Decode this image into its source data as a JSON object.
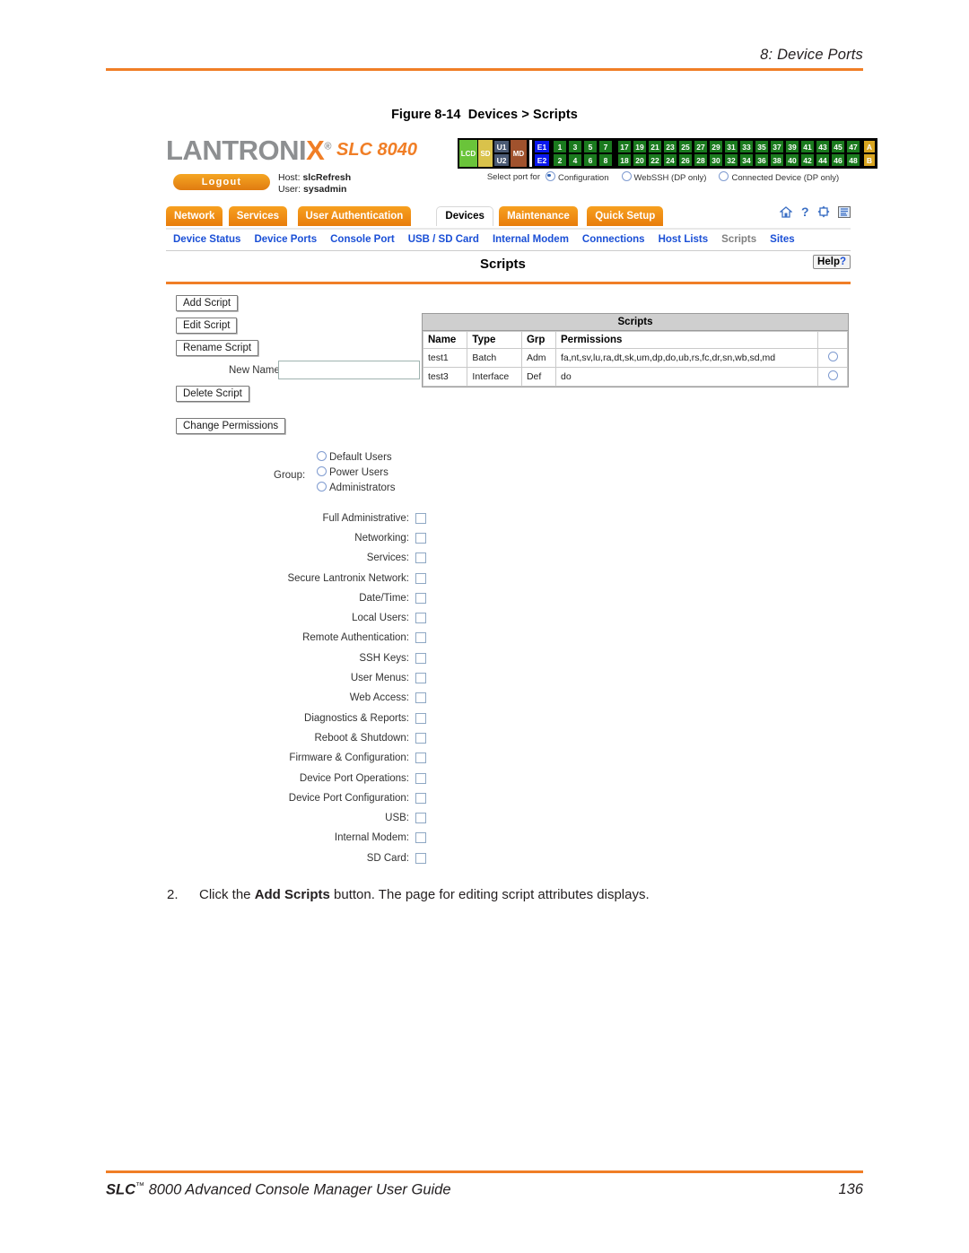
{
  "page": {
    "header_title": "8: Device Ports",
    "figure_caption_number": "Figure 8-14",
    "figure_caption_text": "Devices > Scripts",
    "footer_left_prefix": "SLC",
    "footer_left_tm": "™",
    "footer_left": " 8000 Advanced Console Manager User Guide",
    "footer_page": "136",
    "accent_color": "#F07E26"
  },
  "step": {
    "number": "2.",
    "before": "Click the ",
    "bold": "Add Scripts",
    "after": " button. The page for editing script attributes displays."
  },
  "app": {
    "brand_lan": "LANTRONI",
    "brand_x": "X",
    "brand_reg": "®",
    "model": "SLC 8040",
    "logout_label": "Logout",
    "host_label": "Host:",
    "host_value": "slcRefresh",
    "user_label": "User:",
    "user_value": "sysadmin"
  },
  "port_panel": {
    "status_cells": [
      "LCD",
      "SD"
    ],
    "u_cells": [
      "U1",
      "U2"
    ],
    "md_cell": "MD",
    "e_cells": [
      "E1",
      "E2"
    ],
    "ports_top": [
      "1",
      "3",
      "5",
      "7",
      "17",
      "19",
      "21",
      "23",
      "25",
      "27",
      "29",
      "31",
      "33",
      "35",
      "37",
      "39",
      "41",
      "43",
      "45",
      "47"
    ],
    "ports_bottom": [
      "2",
      "4",
      "6",
      "8",
      "18",
      "20",
      "22",
      "24",
      "26",
      "28",
      "30",
      "32",
      "34",
      "36",
      "38",
      "40",
      "42",
      "44",
      "46",
      "48"
    ],
    "ab_cells": [
      "A",
      "B"
    ],
    "select_label": "Select port for",
    "options": [
      {
        "label": "Configuration",
        "selected": true
      },
      {
        "label": "WebSSH (DP only)",
        "selected": false
      },
      {
        "label": "Connected Device (DP only)",
        "selected": false
      }
    ]
  },
  "nav": {
    "tabs": [
      {
        "label": "Network",
        "active": false
      },
      {
        "label": "Services",
        "active": false
      },
      {
        "label": "User Authentication",
        "active": false
      },
      {
        "label": "Devices",
        "active": true
      },
      {
        "label": "Maintenance",
        "active": false
      },
      {
        "label": "Quick Setup",
        "active": false
      }
    ],
    "icons": [
      "home-icon",
      "help-icon",
      "expand-icon",
      "list-icon"
    ],
    "subnav": [
      {
        "label": "Device Status",
        "current": false
      },
      {
        "label": "Device Ports",
        "current": false
      },
      {
        "label": "Console Port",
        "current": false
      },
      {
        "label": "USB / SD Card",
        "current": false
      },
      {
        "label": "Internal Modem",
        "current": false
      },
      {
        "label": "Connections",
        "current": false
      },
      {
        "label": "Host Lists",
        "current": false
      },
      {
        "label": "Scripts",
        "current": true
      },
      {
        "label": "Sites",
        "current": false
      }
    ]
  },
  "panel": {
    "title": "Scripts",
    "help_label": "Help",
    "help_mark": "?"
  },
  "actions": {
    "add_script": "Add Script",
    "edit_script": "Edit Script",
    "rename_script": "Rename Script",
    "delete_script": "Delete Script",
    "change_permissions": "Change Permissions",
    "new_name_label": "New Name:",
    "new_name_value": "",
    "new_name_placeholder": ""
  },
  "scripts_table": {
    "caption": "Scripts",
    "columns": [
      "Name",
      "Type",
      "Grp",
      "Permissions"
    ],
    "rows": [
      {
        "name": "test1",
        "type": "Batch",
        "grp": "Adm",
        "permissions": "fa,nt,sv,lu,ra,dt,sk,um,dp,do,ub,rs,fc,dr,sn,wb,sd,md",
        "selected": false
      },
      {
        "name": "test3",
        "type": "Interface",
        "grp": "Def",
        "permissions": "do",
        "selected": false
      }
    ]
  },
  "group": {
    "label": "Group:",
    "options": [
      {
        "label": "Default Users",
        "selected": false
      },
      {
        "label": "Power Users",
        "selected": false
      },
      {
        "label": "Administrators",
        "selected": false
      }
    ]
  },
  "permissions": {
    "items": [
      {
        "label": "Full Administrative:",
        "checked": false
      },
      {
        "label": "Networking:",
        "checked": false
      },
      {
        "label": "Services:",
        "checked": false
      },
      {
        "label": "Secure Lantronix Network:",
        "checked": false
      },
      {
        "label": "Date/Time:",
        "checked": false
      },
      {
        "label": "Local Users:",
        "checked": false
      },
      {
        "label": "Remote Authentication:",
        "checked": false
      },
      {
        "label": "SSH Keys:",
        "checked": false
      },
      {
        "label": "User Menus:",
        "checked": false
      },
      {
        "label": "Web Access:",
        "checked": false
      },
      {
        "label": "Diagnostics & Reports:",
        "checked": false
      },
      {
        "label": "Reboot & Shutdown:",
        "checked": false
      },
      {
        "label": "Firmware & Configuration:",
        "checked": false
      },
      {
        "label": "Device Port Operations:",
        "checked": false
      },
      {
        "label": "Device Port Configuration:",
        "checked": false
      },
      {
        "label": "USB:",
        "checked": false
      },
      {
        "label": "Internal Modem:",
        "checked": false
      },
      {
        "label": "SD Card:",
        "checked": false
      }
    ]
  }
}
